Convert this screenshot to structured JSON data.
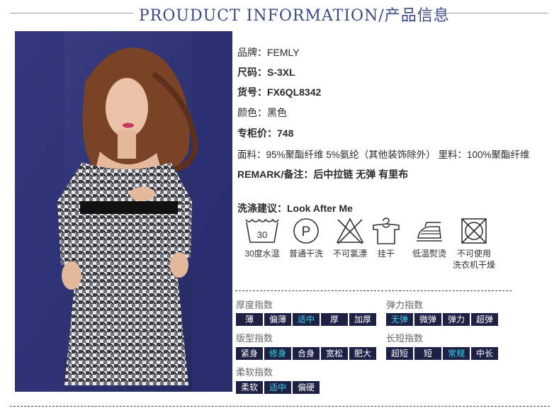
{
  "header": {
    "title": "PROUDUCT INFORMATION/产品信息"
  },
  "info": {
    "brand": {
      "label": "品牌：",
      "value": "FEMLY"
    },
    "size": {
      "label": "尺码：",
      "value": "S-3XL"
    },
    "item_no": {
      "label": "货号：",
      "value": "FX6QL8342"
    },
    "color": {
      "label": "颜色：",
      "value": "黑色"
    },
    "price": {
      "label": "专柜价：",
      "value": "748"
    },
    "fabric": "面料：95%聚酯纤维 5%氨纶（其他装饰除外） 里料：100%聚酯纤维",
    "remark": "REMARK/备注：后中拉链 无弹 有里布"
  },
  "care": {
    "title_label": "洗涤建议：",
    "title_value": "Look After Me",
    "items": [
      {
        "icon": "wash-30-icon",
        "label": "30度水温",
        "label2": ""
      },
      {
        "icon": "dry-clean-icon",
        "label": "普通干洗",
        "label2": ""
      },
      {
        "icon": "no-bleach-icon",
        "label": "不可氯漂",
        "label2": ""
      },
      {
        "icon": "hang-dry-icon",
        "label": "挂干",
        "label2": ""
      },
      {
        "icon": "low-iron-icon",
        "label": "低温熨烫",
        "label2": ""
      },
      {
        "icon": "no-tumble-dry-icon",
        "label": "不可使用",
        "label2": "洗衣机干燥"
      }
    ]
  },
  "indices": {
    "thickness": {
      "title": "厚度指数",
      "options": [
        "薄",
        "偏薄",
        "适中",
        "厚",
        "加厚"
      ],
      "selected": "适中"
    },
    "elasticity": {
      "title": "弹力指数",
      "options": [
        "无弹",
        "微弹",
        "弹力",
        "超弹"
      ],
      "selected": "无弹"
    },
    "fit": {
      "title": "版型指数",
      "options": [
        "紧身",
        "修身",
        "合身",
        "宽松",
        "肥大"
      ],
      "selected": "修身"
    },
    "length": {
      "title": "长短指数",
      "options": [
        "超短",
        "短",
        "常规",
        "中长"
      ],
      "selected": "常规"
    },
    "softness": {
      "title": "柔软指数",
      "options": [
        "柔软",
        "适中",
        "偏硬"
      ],
      "selected": "适中"
    }
  },
  "colors": {
    "header_blue": "#3a4a86",
    "chip_bg": "#1d2146",
    "chip_active": "#37d6e8"
  }
}
